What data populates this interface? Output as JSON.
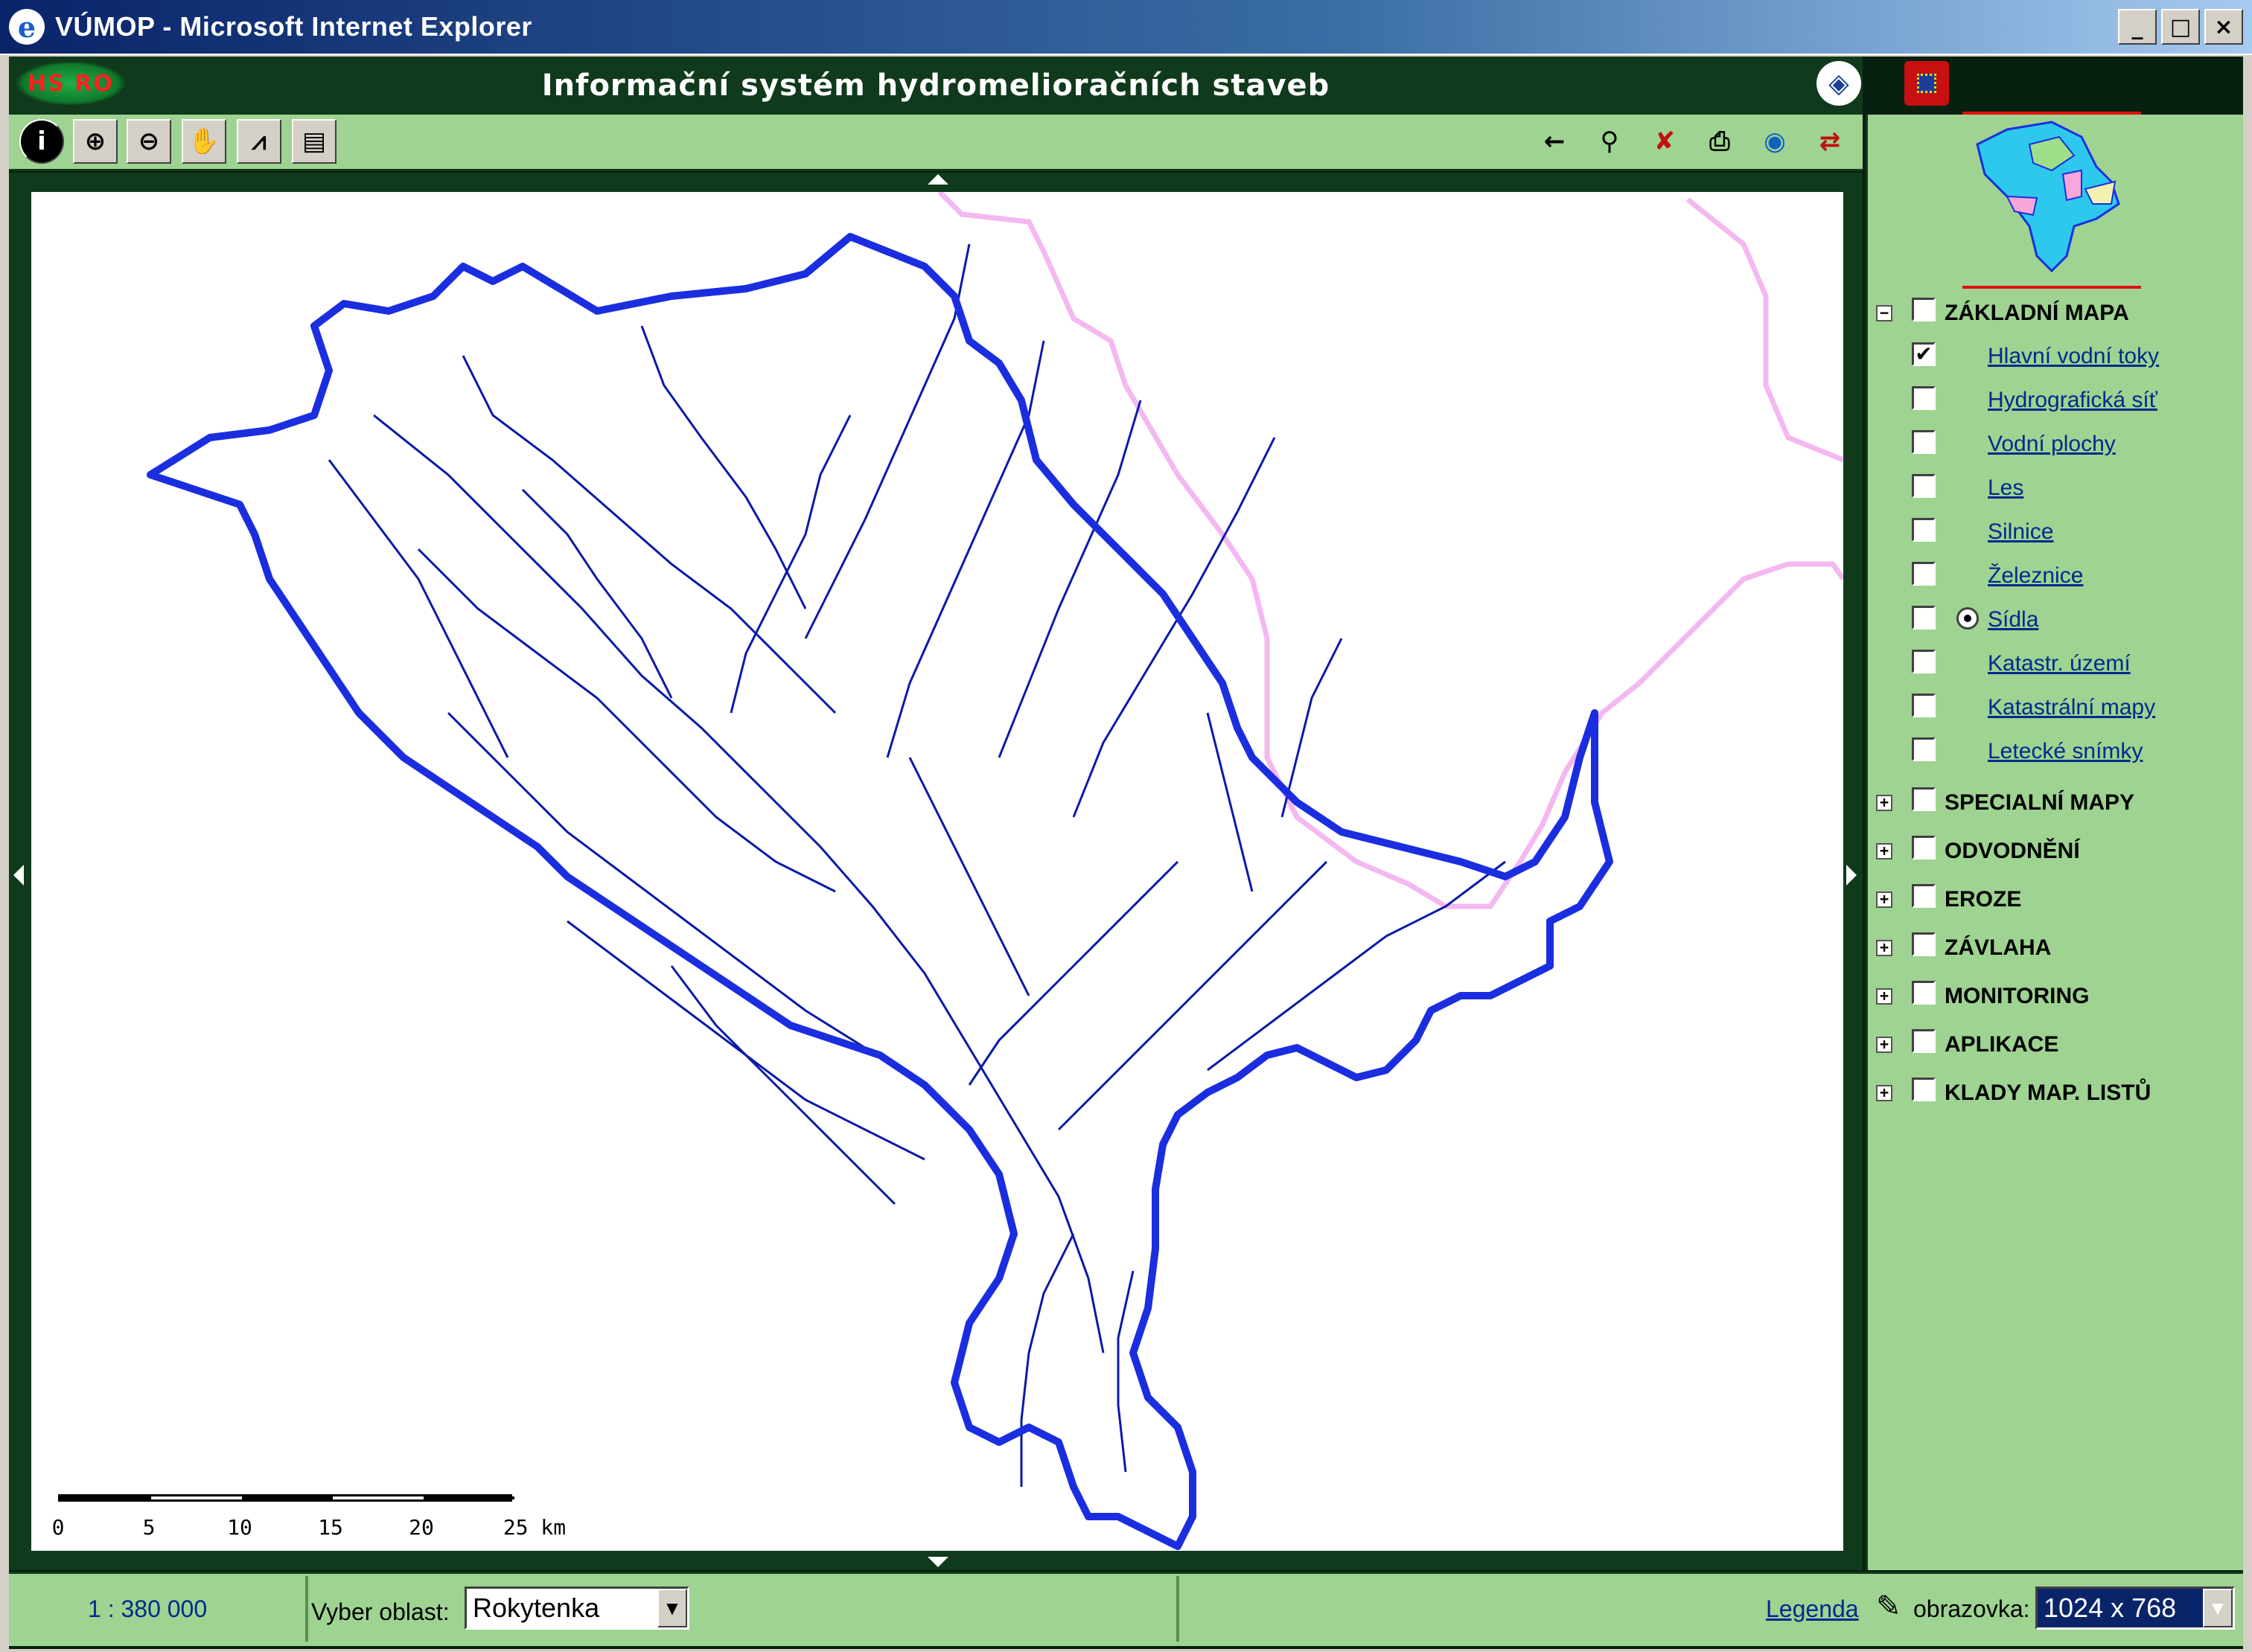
{
  "window": {
    "title": "VÚMOP - Microsoft Internet Explorer",
    "minimize_label": "_",
    "maximize_label": "□",
    "close_label": "×"
  },
  "header": {
    "logo_text": "HS RO",
    "title": "Informační systém hydromelioračních staveb"
  },
  "toolbar": {
    "left_tools": [
      {
        "icon": "info-icon",
        "glyph": "i"
      },
      {
        "icon": "zoom-in-icon",
        "glyph": "⊕"
      },
      {
        "icon": "zoom-out-icon",
        "glyph": "⊖"
      },
      {
        "icon": "pan-hand-icon",
        "glyph": "✋"
      },
      {
        "icon": "measure-icon",
        "glyph": "⩘"
      },
      {
        "icon": "select-area-icon",
        "glyph": "▤"
      }
    ],
    "right_tools": [
      {
        "icon": "back-arrow-icon",
        "glyph": "←"
      },
      {
        "icon": "find-binoculars-icon",
        "glyph": "👓"
      },
      {
        "icon": "clear-selection-icon",
        "glyph": "✘"
      },
      {
        "icon": "print-icon",
        "glyph": "🖶"
      },
      {
        "icon": "globe-icon",
        "glyph": "🌐"
      },
      {
        "icon": "refresh-icon",
        "glyph": "⇄"
      }
    ]
  },
  "map": {
    "scale_labels": [
      "0",
      "5",
      "10",
      "15",
      "20",
      "25 km"
    ],
    "colors": {
      "basin_boundary": "#1a2ee0",
      "rivers": "#0a1aa8",
      "admin_boundary": "#f4b8f0"
    }
  },
  "layers": {
    "base_group": {
      "label": "ZÁKLADNÍ MAPA",
      "expanded": true
    },
    "items": [
      {
        "label": "Hlavní vodní toky",
        "checked": true
      },
      {
        "label": "Hydrografická síť",
        "checked": false
      },
      {
        "label": "Vodní plochy",
        "checked": false
      },
      {
        "label": "Les",
        "checked": false
      },
      {
        "label": "Silnice",
        "checked": false
      },
      {
        "label": "Železnice",
        "checked": false
      },
      {
        "label": "Sídla",
        "checked": false,
        "active_radio": true
      },
      {
        "label": "Katastr. území",
        "checked": false
      },
      {
        "label": "Katastrální mapy",
        "checked": false
      },
      {
        "label": "Letecké snímky",
        "checked": false
      }
    ],
    "groups": [
      {
        "label": "SPECIALNÍ MAPY"
      },
      {
        "label": "ODVODNĚNÍ"
      },
      {
        "label": "EROZE"
      },
      {
        "label": "ZÁVLAHA"
      },
      {
        "label": "MONITORING"
      },
      {
        "label": "APLIKACE"
      },
      {
        "label": "KLADY MAP. LISTŮ"
      }
    ]
  },
  "status": {
    "scale": "1 : 380 000",
    "region_label": "Vyber oblast:",
    "region_value": "Rokytenka",
    "legend_link": "Legenda",
    "screen_label": "obrazovka:",
    "screen_value": "1024 x 768"
  }
}
